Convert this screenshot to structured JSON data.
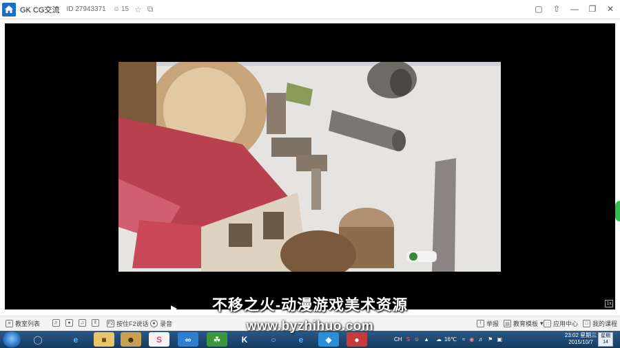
{
  "title_bar": {
    "room_name": "GK CG交流",
    "room_id": "ID 27943371",
    "online_count": "15"
  },
  "video": {
    "subtitle": "不移之火-动漫游戏美术资源",
    "fullscreen_label": "1x"
  },
  "watermark": "www.byzhihuo.com",
  "toolbar": {
    "left_items": [
      {
        "icon": "list-icon",
        "label": "教室列表"
      },
      {
        "icon": "speaker-icon",
        "label": ""
      },
      {
        "icon": "microphone-icon",
        "label": ""
      },
      {
        "icon": "music-icon",
        "label": ""
      },
      {
        "icon": "equalizer-icon",
        "label": ""
      },
      {
        "icon": "f2-icon",
        "label": "按住F2说话"
      },
      {
        "icon": "record-icon",
        "label": "录音"
      }
    ],
    "right_items": [
      {
        "icon": "report-icon",
        "label": "举报"
      },
      {
        "icon": "template-icon",
        "label": "教育模板"
      },
      {
        "icon": "apps-icon",
        "label": "应用中心"
      },
      {
        "icon": "book-icon",
        "label": "我的课程"
      }
    ]
  },
  "taskbar": {
    "ime": "CH",
    "temperature": "16℃",
    "time": "23:02 星期三",
    "date": "2015/10/7",
    "calendar_top": "星期",
    "calendar_day": "14"
  },
  "colors": {
    "accent": "#1a6fc9",
    "stage": "#000000",
    "taskbar": "#1f4a73"
  }
}
